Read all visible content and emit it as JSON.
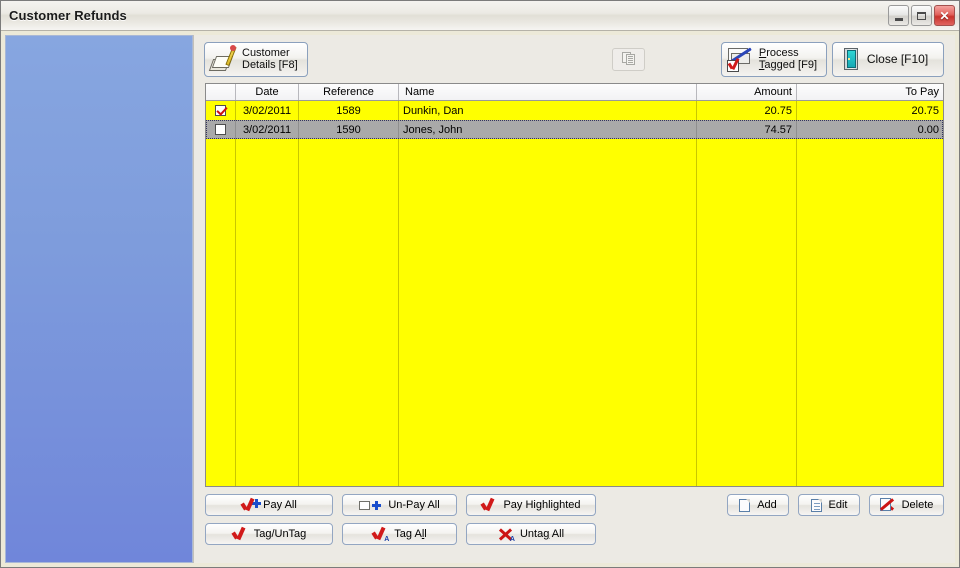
{
  "window": {
    "title": "Customer Refunds",
    "controls": {
      "minimize": "minimize-button",
      "maximize": "maximize-button",
      "close": "close-button",
      "close_glyph": "✕"
    }
  },
  "toolbar": {
    "customer_details": {
      "line1": "Customer",
      "line2": "Details [F8]",
      "icon": "pencil-notepad-icon"
    },
    "copy_disabled": {
      "icon": "copy-documents-icon",
      "enabled": false
    },
    "process_tagged": {
      "line1_pre": "P",
      "line1_post": "rocess",
      "line2_pre": "T",
      "line2_post": "agged [F9]",
      "icon": "process-tagged-icon"
    },
    "close": {
      "label": "Close [F10]",
      "icon": "exit-door-icon"
    }
  },
  "grid": {
    "columns": [
      {
        "key": "tag",
        "label": ""
      },
      {
        "key": "date",
        "label": "Date"
      },
      {
        "key": "reference",
        "label": "Reference"
      },
      {
        "key": "name",
        "label": "Name"
      },
      {
        "key": "amount",
        "label": "Amount"
      },
      {
        "key": "topay",
        "label": "To Pay"
      }
    ],
    "rows": [
      {
        "tagged": true,
        "state": "tagged",
        "date": "3/02/2011",
        "reference": "1589",
        "name": "Dunkin, Dan",
        "amount": "20.75",
        "topay": "20.75"
      },
      {
        "tagged": false,
        "state": "current",
        "date": "3/02/2011",
        "reference": "1590",
        "name": "Jones, John",
        "amount": "74.57",
        "topay": "0.00"
      }
    ]
  },
  "buttons": {
    "pay_all": {
      "label": "Pay All",
      "icon": "red-check-plus-icon"
    },
    "unpay_all": {
      "label": "Un-Pay All",
      "icon": "empty-box-plus-icon"
    },
    "pay_highlighted": {
      "label": "Pay Highlighted",
      "icon": "red-check-icon"
    },
    "tag_untag": {
      "label": "Tag/UnTag",
      "icon": "red-check-icon"
    },
    "tag_all": {
      "pre": "Tag A",
      "accel": "l",
      "post": "l",
      "icon": "red-check-a-icon"
    },
    "untag_all": {
      "pre": "Unta",
      "accel": "g",
      "post": " All",
      "icon": "red-x-a-icon"
    },
    "add": {
      "label": "Add",
      "icon": "new-document-icon"
    },
    "edit": {
      "label": "Edit",
      "icon": "edit-document-icon"
    },
    "delete": {
      "label": "Delete",
      "icon": "delete-document-icon"
    }
  },
  "colors": {
    "tagged_row": "#ffff00",
    "current_row": "#a9a9a9",
    "sidebar": "#7e9cdc",
    "panel": "#eceae4",
    "accent_red": "#cc1414",
    "accent_blue": "#1a4ecc"
  }
}
